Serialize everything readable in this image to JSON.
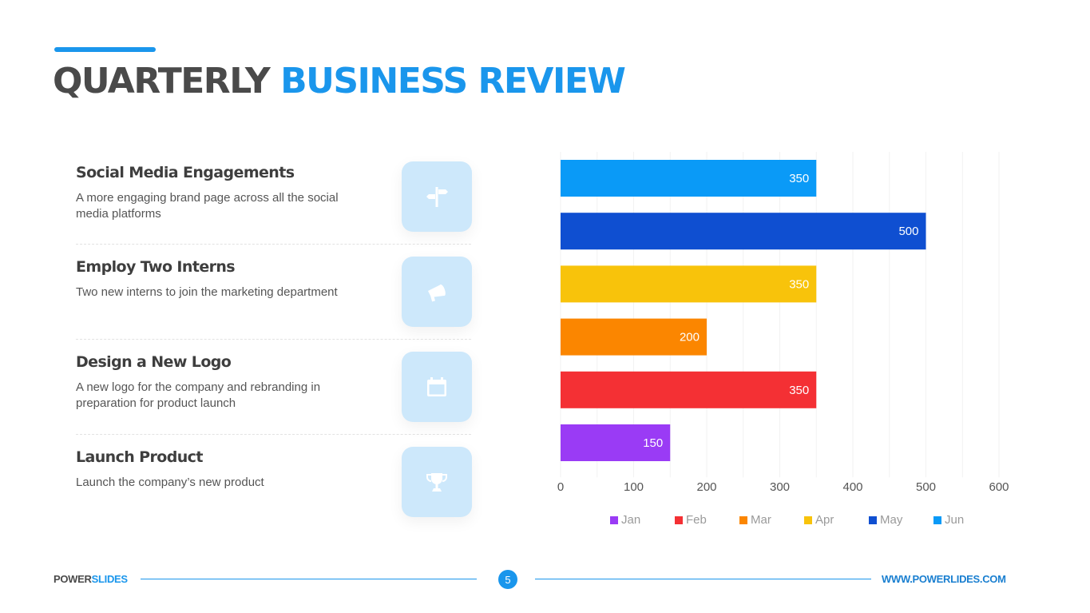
{
  "header": {
    "title_part1": "QUARTERLY",
    "title_part2": "BUSINESS REVIEW"
  },
  "items": [
    {
      "title": "Social Media Engagements",
      "description": "A more engaging brand page across all the social media platforms",
      "icon": "signpost-icon"
    },
    {
      "title": "Employ Two Interns",
      "description": "Two new interns to join the marketing department",
      "icon": "megaphone-icon"
    },
    {
      "title": "Design a New Logo",
      "description": "A new logo for the company and rebranding in preparation for product launch",
      "icon": "calendar-icon"
    },
    {
      "title": "Launch Product",
      "description": "Launch the company’s new product",
      "icon": "trophy-icon"
    }
  ],
  "colors": {
    "accent": "#1a96ec",
    "icon_bg": "#cde8fb"
  },
  "chart_data": {
    "type": "bar",
    "orientation": "horizontal",
    "title": "",
    "xlabel": "",
    "ylabel": "",
    "categories": [
      "Jun",
      "May",
      "Apr",
      "Mar",
      "Feb",
      "Jan"
    ],
    "values": [
      350,
      500,
      350,
      200,
      350,
      150
    ],
    "colors": [
      "#0a9af7",
      "#0f4fd1",
      "#f8c30b",
      "#fb8600",
      "#f43034",
      "#9a3bf5"
    ],
    "xlim": [
      0,
      600
    ],
    "xticks": [
      0,
      100,
      200,
      300,
      400,
      500,
      600
    ],
    "grid": true,
    "data_labels": true,
    "legend": {
      "placement": "bottom",
      "entries": [
        {
          "label": "Jan",
          "color": "#9a3bf5"
        },
        {
          "label": "Feb",
          "color": "#f43034"
        },
        {
          "label": "Mar",
          "color": "#fb8600"
        },
        {
          "label": "Apr",
          "color": "#f8c30b"
        },
        {
          "label": "May",
          "color": "#0f4fd1"
        },
        {
          "label": "Jun",
          "color": "#0a9af7"
        }
      ]
    }
  },
  "footer": {
    "brand_part1": "POWER",
    "brand_part2": "SLIDES",
    "page_number": "5",
    "url": "WWW.POWERLIDES.COM"
  }
}
